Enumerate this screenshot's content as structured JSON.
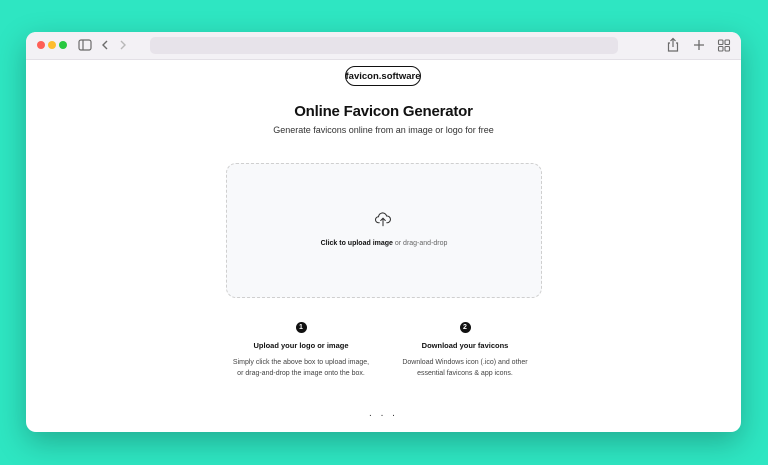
{
  "browser": {
    "traffic_lights": [
      "#fe5f57",
      "#febc2e",
      "#28c840"
    ],
    "url": "",
    "icons": [
      "sidebar-icon",
      "back-icon",
      "forward-icon",
      "share-icon",
      "new-tab-icon",
      "tab-overview-icon"
    ]
  },
  "page": {
    "brand": "favicon.software",
    "title": "Online Favicon Generator",
    "subtitle": "Generate favicons online from an image or logo for free",
    "upload": {
      "icon": "cloud-upload-icon",
      "action": "Click to upload image",
      "alt": " or drag-and-drop"
    },
    "steps": [
      {
        "number": "1",
        "title": "Upload your logo or image",
        "line1": "Simply click the above box to upload image,",
        "line2": "or drag-and-drop the image onto the box."
      },
      {
        "number": "2",
        "title": "Download your favicons",
        "line1": "Download Windows icon (.ico) and other",
        "line2": "essential favicons & app icons."
      }
    ],
    "more": ". . ."
  },
  "colors": {
    "background": "#2ee6c2",
    "text": "#111111"
  }
}
